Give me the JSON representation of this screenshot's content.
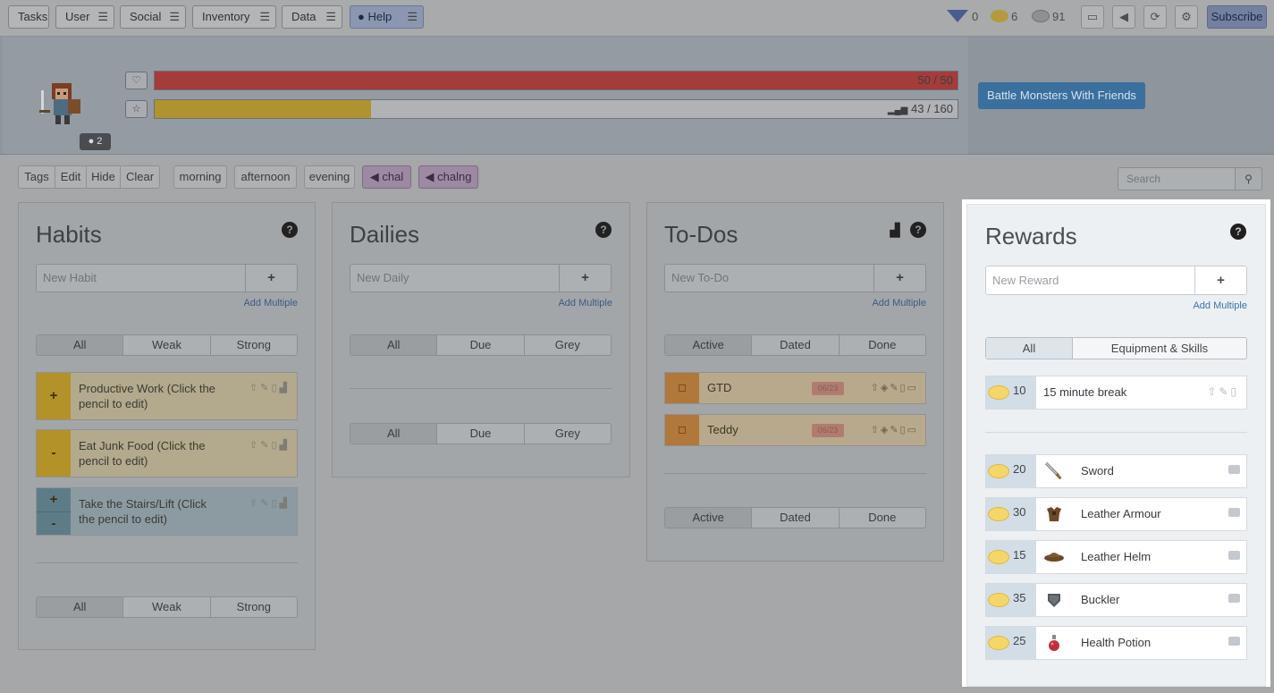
{
  "nav": {
    "items": [
      {
        "label": "Tasks",
        "has_menu": false
      },
      {
        "label": "User",
        "has_menu": true
      },
      {
        "label": "Social",
        "has_menu": true
      },
      {
        "label": "Inventory",
        "has_menu": true
      },
      {
        "label": "Data",
        "has_menu": true
      },
      {
        "label": "Help",
        "has_menu": true
      }
    ],
    "menu_glyph": "☰",
    "gems": "0",
    "gold": "6",
    "silver": "91",
    "subscribe": "Subscribe"
  },
  "header": {
    "level_badge": "2",
    "health_value": "50 / 50",
    "exp_value": "43 / 160",
    "health_fraction": 1.0,
    "exp_fraction": 0.27,
    "battle_button": "Battle Monsters With Friends"
  },
  "filters": {
    "tags": "Tags",
    "edit": "Edit",
    "hide": "Hide",
    "clear": "Clear",
    "tag_list": [
      "morning",
      "afternoon",
      "evening",
      "chal",
      "chalng"
    ],
    "search_placeholder": "Search"
  },
  "habits": {
    "title": "Habits",
    "placeholder": "New Habit",
    "add_multiple": "Add Multiple",
    "filters": [
      "All",
      "Weak",
      "Strong"
    ],
    "items": [
      {
        "text": "Productive Work (Click the pencil to edit)",
        "sign": "+"
      },
      {
        "text": "Eat Junk Food (Click the pencil to edit)",
        "sign": "-"
      },
      {
        "text": "Take the Stairs/Lift (Click the pencil to edit)",
        "sign": "+-"
      }
    ]
  },
  "dailies": {
    "title": "Dailies",
    "placeholder": "New Daily",
    "add_multiple": "Add Multiple",
    "filters": [
      "All",
      "Due",
      "Grey"
    ]
  },
  "todos": {
    "title": "To-Dos",
    "placeholder": "New To-Do",
    "add_multiple": "Add Multiple",
    "filters": [
      "Active",
      "Dated",
      "Done"
    ],
    "items": [
      {
        "text": "GTD",
        "date": "06/23"
      },
      {
        "text": "Teddy",
        "date": "06/23"
      }
    ]
  },
  "rewards": {
    "title": "Rewards",
    "placeholder": "New Reward",
    "add_multiple": "Add Multiple",
    "filters": [
      "All",
      "Equipment & Skills"
    ],
    "custom": [
      {
        "price": "10",
        "text": "15 minute break"
      }
    ],
    "equipment": [
      {
        "price": "20",
        "text": "Sword",
        "icon": "sword-icon"
      },
      {
        "price": "30",
        "text": "Leather Armour",
        "icon": "armor-icon"
      },
      {
        "price": "15",
        "text": "Leather Helm",
        "icon": "helm-icon"
      },
      {
        "price": "35",
        "text": "Buckler",
        "icon": "shield-icon"
      },
      {
        "price": "25",
        "text": "Health Potion",
        "icon": "potion-icon"
      }
    ]
  },
  "colors": {
    "accent_blue": "#2c75c4",
    "health": "#b53a3a",
    "experience": "#c9a51e",
    "gold": "#f3d76a"
  }
}
